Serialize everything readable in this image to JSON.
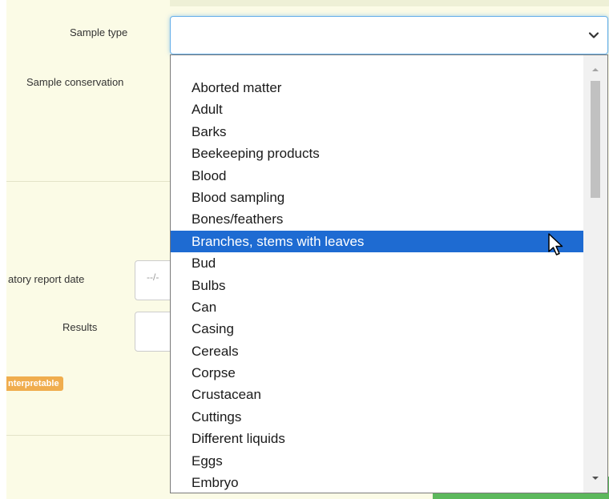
{
  "form": {
    "sample_type_label": "Sample type",
    "sample_conservation_label": "Sample conservation",
    "lab_report_date_label": "atory report date",
    "lab_report_date_placeholder": "--/-",
    "results_label": "Results",
    "status_badge": "nterpretable"
  },
  "select": {
    "value": "",
    "caret_icon": "chevron-down-icon"
  },
  "dropdown": {
    "selected_index": 7,
    "options": [
      "Aborted matter",
      "Adult",
      "Barks",
      "Beekeeping products",
      "Blood",
      "Blood sampling",
      "Bones/feathers",
      "Branches, stems with leaves",
      "Bud",
      "Bulbs",
      "Can",
      "Casing",
      "Cereals",
      "Corpse",
      "Crustacean",
      "Cuttings",
      "Different liquids",
      "Eggs",
      "Embryo"
    ]
  },
  "colors": {
    "panel_bg": "#fbfbe6",
    "highlight": "#1e6bd2",
    "badge": "#f0ad4e",
    "focus_border": "#66afe9"
  }
}
